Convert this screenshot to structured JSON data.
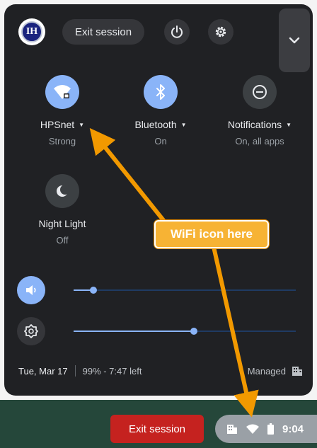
{
  "topbar": {
    "avatar_initials": "IH",
    "exit_label": "Exit session"
  },
  "tiles": [
    {
      "label": "HPSnet",
      "sub": "Strong",
      "icon": "wifi-lock-icon",
      "state": "on"
    },
    {
      "label": "Bluetooth",
      "sub": "On",
      "icon": "bluetooth-icon",
      "state": "on"
    },
    {
      "label": "Notifications",
      "sub": "On, all apps",
      "icon": "do-not-disturb-icon",
      "state": "off"
    },
    {
      "label": "Night Light",
      "sub": "Off",
      "icon": "night-light-icon",
      "state": "off"
    }
  ],
  "sliders": {
    "volume": {
      "icon": "volume-icon",
      "level": 0.09
    },
    "brightness": {
      "icon": "brightness-icon",
      "level": 0.54
    }
  },
  "footer": {
    "date": "Tue, Mar 17",
    "battery": "99% - 7:47 left",
    "managed": "Managed"
  },
  "shelf": {
    "exit_label": "Exit session",
    "time": "9:04"
  },
  "annotation": {
    "callout": "WiFi icon here",
    "color": "#f7b334"
  }
}
